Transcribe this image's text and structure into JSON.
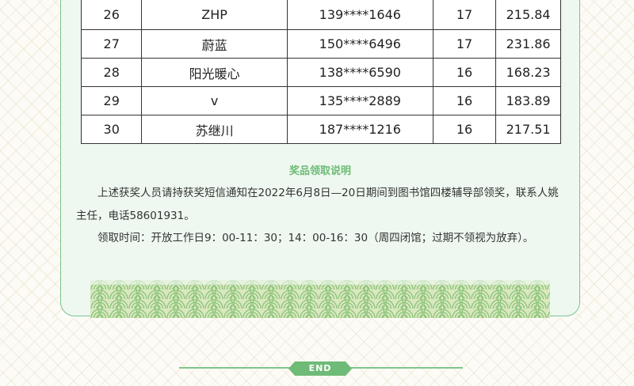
{
  "table": {
    "rows": [
      {
        "no": "26",
        "name": "ZHP",
        "phone": "139****1646",
        "score": "17",
        "time": "215.84"
      },
      {
        "no": "27",
        "name": "蔚蓝",
        "phone": "150****6496",
        "score": "17",
        "time": "231.86"
      },
      {
        "no": "28",
        "name": "阳光暖心",
        "phone": "138****6590",
        "score": "16",
        "time": "168.23"
      },
      {
        "no": "29",
        "name": "v",
        "phone": "135****2889",
        "score": "16",
        "time": "183.89"
      },
      {
        "no": "30",
        "name": "苏继川",
        "phone": "187****1216",
        "score": "16",
        "time": "217.51"
      }
    ]
  },
  "notice": {
    "title": "奖品领取说明",
    "paragraph1": "上述获奖人员请持获奖短信通知在2022年6月8日—20日期间到图书馆四楼辅导部领奖，联系人姚主任，电话58601931。",
    "paragraph2": "领取时间：开放工作日9：00-11：30；14：00-16：30（周四闭馆；过期不领视为放弃）。"
  },
  "end_label": "END",
  "colors": {
    "accent": "#6dbb76",
    "card_background": "#eef8f0",
    "wave_light": "#e6f0d2",
    "wave_dark": "#8cc47a"
  }
}
